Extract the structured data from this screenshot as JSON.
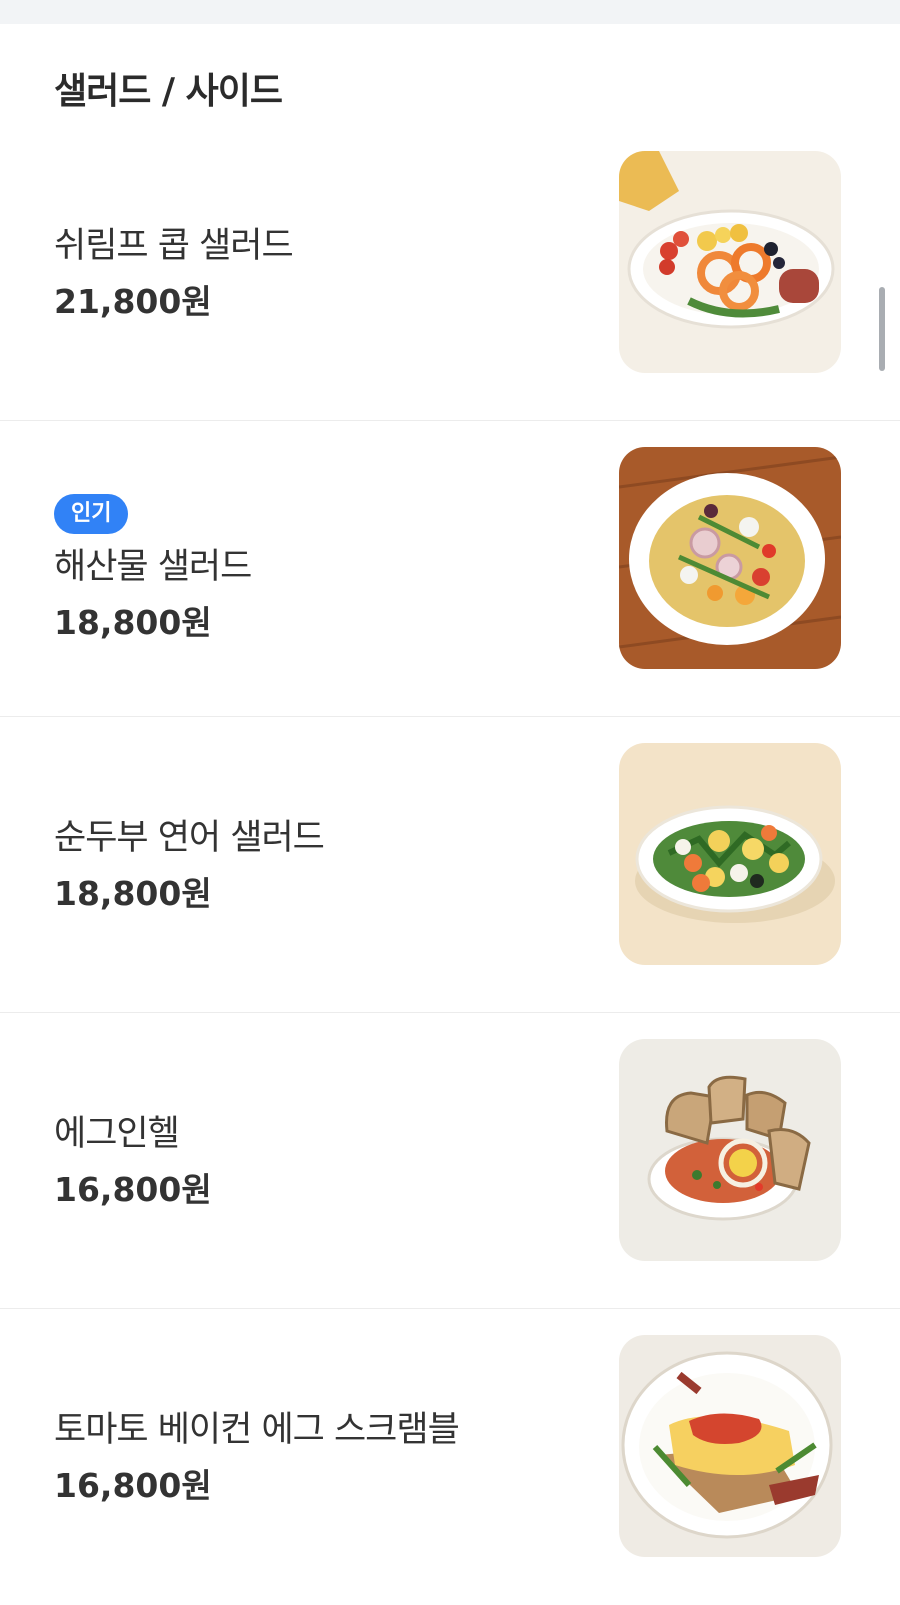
{
  "section": {
    "title": "샐러드 / 사이드"
  },
  "items": [
    {
      "name": "쉬림프 콥 샐러드",
      "price": "21,800원",
      "badge": "",
      "image_icon": "shrimp-cobb-salad-photo"
    },
    {
      "name": "해산물 샐러드",
      "price": "18,800원",
      "badge": "인기",
      "image_icon": "seafood-salad-photo"
    },
    {
      "name": "순두부 연어 샐러드",
      "price": "18,800원",
      "badge": "",
      "image_icon": "tofu-salmon-salad-photo"
    },
    {
      "name": "에그인헬",
      "price": "16,800원",
      "badge": "",
      "image_icon": "egg-in-hell-photo"
    },
    {
      "name": "토마토 베이컨 에그 스크램블",
      "price": "16,800원",
      "badge": "",
      "image_icon": "tomato-bacon-egg-scramble-photo"
    }
  ],
  "colors": {
    "badge": "#3182f6",
    "divider": "#ececec",
    "header_band": "#f2f4f6"
  }
}
